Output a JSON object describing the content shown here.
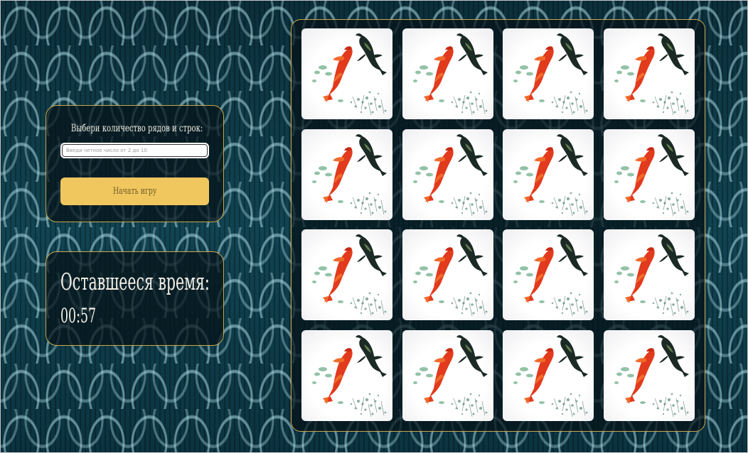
{
  "settings": {
    "label": "Выбери количество рядов и строк:",
    "input_placeholder": "Введи четное число от 2 до 10",
    "input_value": "",
    "start_label": "Начать игру"
  },
  "timer": {
    "title": "Оставшееся время:",
    "value": "00:57"
  },
  "board": {
    "rows": 4,
    "columns": 4,
    "card_image": "koi-fish-card-back"
  },
  "colors": {
    "accent_gold": "#c9a84a",
    "button_yellow": "#efc75e",
    "background_teal": "#0e3845"
  }
}
